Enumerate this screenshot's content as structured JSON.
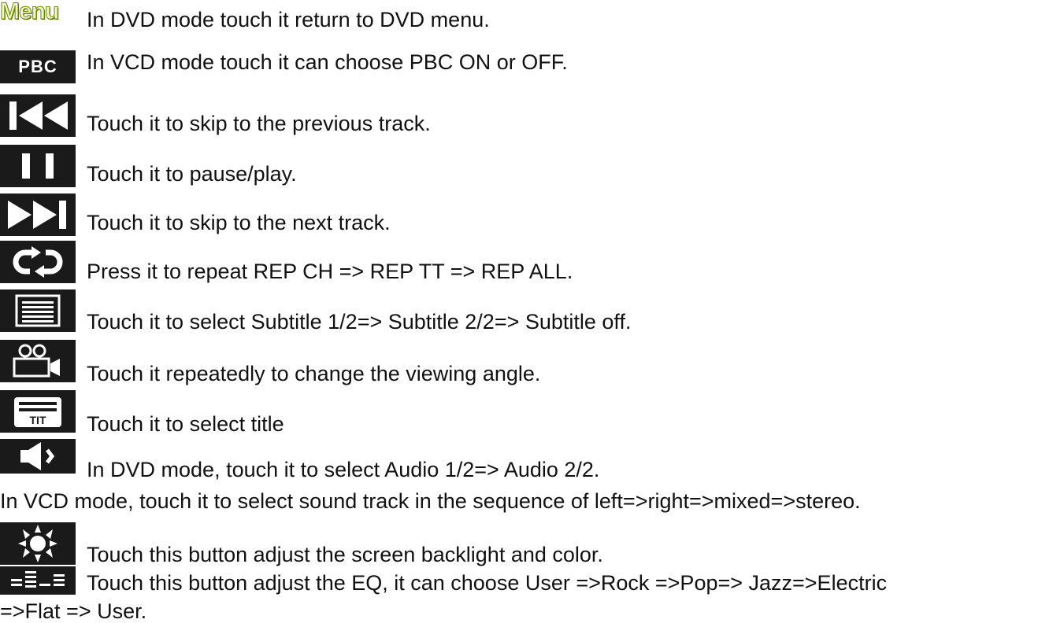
{
  "items": [
    {
      "icon": "menu-text-icon",
      "icon_label": "Menu",
      "text": "In DVD mode touch it return to DVD menu."
    },
    {
      "icon": "pbc-text-icon",
      "icon_label": "PBC",
      "text": "In VCD mode touch it can choose PBC ON or OFF."
    },
    {
      "icon": "skip-previous-icon",
      "text": "Touch it to skip to the previous track."
    },
    {
      "icon": "pause-icon",
      "text": "Touch it to pause/play."
    },
    {
      "icon": "skip-next-icon",
      "text": "Touch it to skip to the next track."
    },
    {
      "icon": "repeat-icon",
      "text": "Press it to repeat REP CH => REP TT => REP ALL."
    },
    {
      "icon": "subtitle-icon",
      "text": "Touch it to select Subtitle 1/2=> Subtitle 2/2=> Subtitle off."
    },
    {
      "icon": "camera-angle-icon",
      "text": "Touch it repeatedly to change the viewing angle."
    },
    {
      "icon": "title-icon",
      "text": "Touch it to select title"
    },
    {
      "icon": "audio-icon",
      "text": "In DVD mode, touch it to select Audio 1/2=> Audio 2/2.",
      "text2": "In VCD mode, touch it to select sound track in the sequence of left=>right=>mixed=>stereo."
    },
    {
      "icon": "brightness-icon",
      "text": "Touch this button adjust the screen backlight and color."
    },
    {
      "icon": "equalizer-icon",
      "text": "Touch this button adjust the EQ, it can choose User =>Rock =>Pop=> Jazz=>Electric",
      "text2": "=>Flat => User."
    }
  ]
}
